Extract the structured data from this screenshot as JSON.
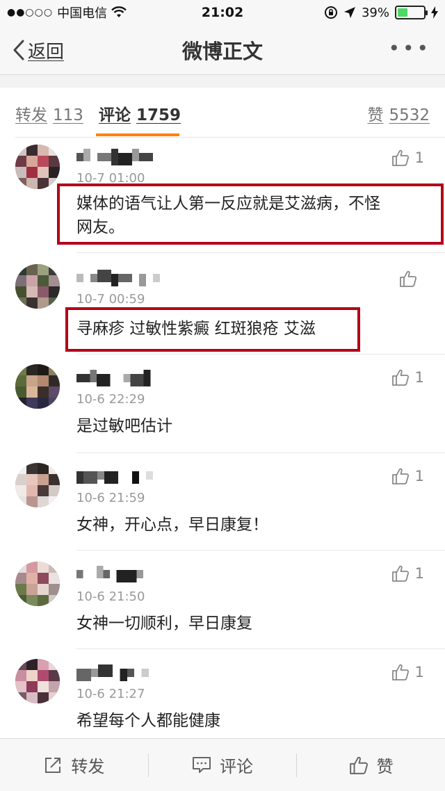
{
  "status_bar": {
    "carrier": "中国电信",
    "signal_dots": "●●○○○",
    "time": "21:02",
    "battery": "39%",
    "battery_level": 0.39
  },
  "nav": {
    "back_label": "返回",
    "title": "微博正文",
    "more": "•••"
  },
  "tabs": {
    "repost_label": "转发",
    "repost_count": "113",
    "comment_label": "评论",
    "comment_count": "1759",
    "like_label": "赞",
    "like_count": "5532"
  },
  "comments": [
    {
      "time": "10-7 01:00",
      "text_line1": "媒体的语气让人第一反应就是艾滋病，不怪",
      "text_line2": "网友。",
      "likes": "1"
    },
    {
      "time": "10-7 00:59",
      "text_line1": "寻麻疹 过敏性紫癜 红斑狼疮 艾滋",
      "text_line2": "",
      "likes": ""
    },
    {
      "time": "10-6 22:29",
      "text_line1": "是过敏吧估计",
      "text_line2": "",
      "likes": "1"
    },
    {
      "time": "10-6 21:59",
      "text_line1": "女神，开心点，早日康复！",
      "text_line2": "",
      "likes": "1"
    },
    {
      "time": "10-6 21:50",
      "text_line1": "女神一切顺利，早日康复",
      "text_line2": "",
      "likes": "1"
    },
    {
      "time": "10-6 21:27",
      "text_line1": "希望每个人都能健康",
      "text_line2": "",
      "likes": "1"
    }
  ],
  "bottom_bar": {
    "repost_label": "转发",
    "comment_label": "评论",
    "like_label": "赞"
  },
  "colors": {
    "accent": "#ff8200",
    "highlight": "#b3001b"
  }
}
